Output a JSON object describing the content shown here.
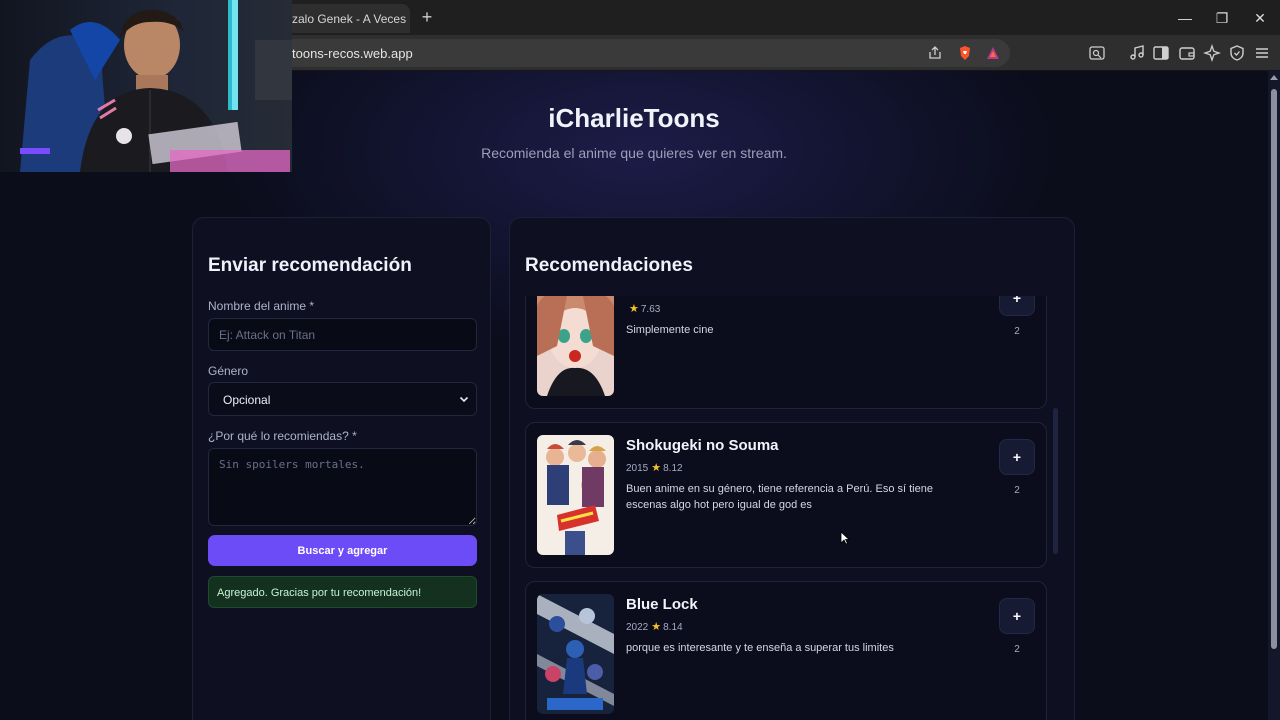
{
  "browser": {
    "tab_title": "zalo Genek - A Veces (Au",
    "new_tab": "+",
    "url": "toons-recos.web.app",
    "window_controls": [
      "—",
      "❐",
      "✕"
    ]
  },
  "site": {
    "title": "iCharlieToons",
    "subtitle": "Recomienda el anime que quieres ver en stream."
  },
  "form": {
    "heading": "Enviar recomendación",
    "name_label": "Nombre del anime *",
    "name_placeholder": "Ej: Attack on Titan",
    "genre_label": "Género",
    "genre_value": "Opcional",
    "reason_label": "¿Por qué lo recomiendas? *",
    "reason_placeholder": "Sin spoilers mortales.",
    "submit_label": "Buscar y agregar",
    "success_message": "Agregado. Gracias por tu recomendación!"
  },
  "recommendations": {
    "heading": "Recomendaciones",
    "items": [
      {
        "title": "",
        "year": "",
        "score": "7.63",
        "comment": "Simplemente cine",
        "vote_label": "+",
        "votes": "2",
        "cover_colors": [
          "#f3c9c2",
          "#6a3b2c",
          "#1d1d26"
        ]
      },
      {
        "title": "Shokugeki no Souma",
        "year": "2015",
        "score": "8.12",
        "comment": "Buen anime en su género, tiene referencia a Perú. Eso sí tiene escenas algo hot pero igual de god es",
        "vote_label": "+",
        "votes": "2",
        "cover_colors": [
          "#f3ece4",
          "#c7463c",
          "#3b4f8a"
        ]
      },
      {
        "title": "Blue Lock",
        "year": "2022",
        "score": "8.14",
        "comment": "porque es interesante y te enseña a superar tus limites",
        "vote_label": "+",
        "votes": "2",
        "cover_colors": [
          "#1b2a4a",
          "#e6ecf4",
          "#2d5fb4"
        ]
      }
    ]
  },
  "colors": {
    "accent": "#6b4cf6",
    "background": "#0b0d1b",
    "success_bg": "#14301f",
    "star": "#f5c226"
  }
}
